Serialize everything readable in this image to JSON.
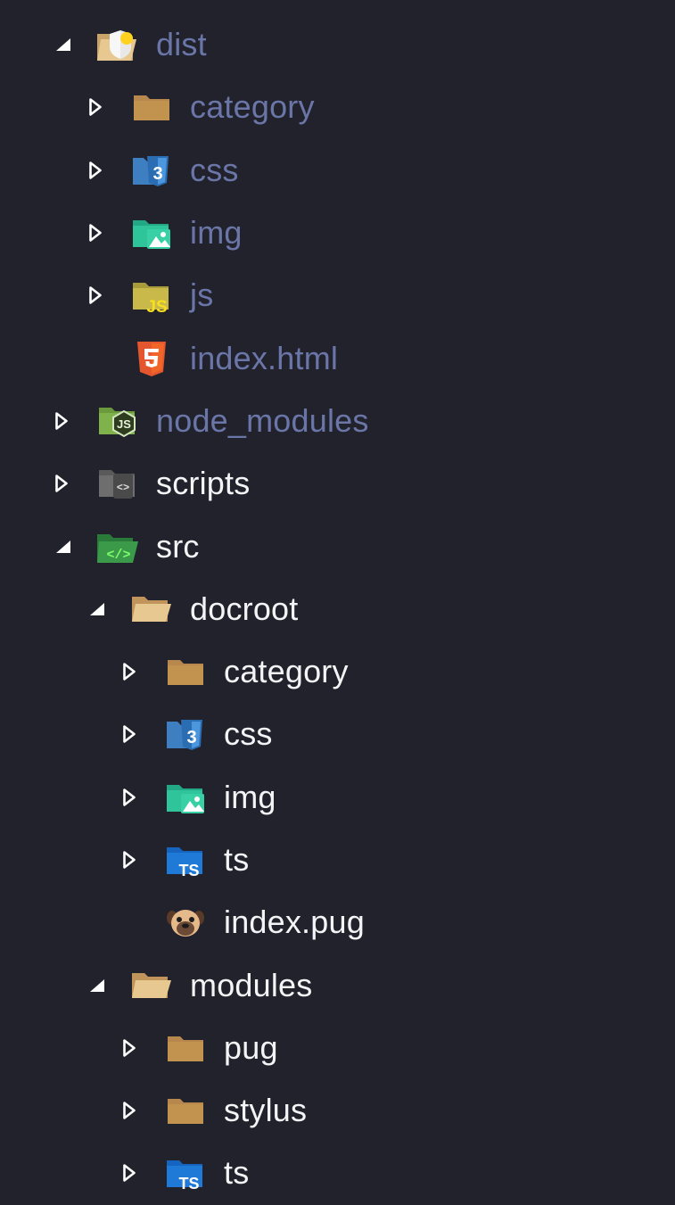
{
  "colors": {
    "background": "#21222c",
    "ignored_text": "#6b76a8",
    "normal_text": "#f4f4f6"
  },
  "tree": {
    "dist": {
      "label": "dist",
      "icon": "folder-dist-open-icon",
      "expanded": true
    },
    "dist_category": {
      "label": "category",
      "icon": "folder-icon"
    },
    "dist_css": {
      "label": "css",
      "icon": "folder-css-icon"
    },
    "dist_img": {
      "label": "img",
      "icon": "folder-images-icon"
    },
    "dist_js": {
      "label": "js",
      "icon": "folder-js-icon"
    },
    "dist_index_html": {
      "label": "index.html",
      "icon": "html5-file-icon"
    },
    "node_modules": {
      "label": "node_modules",
      "icon": "folder-node-icon"
    },
    "scripts": {
      "label": "scripts",
      "icon": "folder-scripts-icon"
    },
    "src": {
      "label": "src",
      "icon": "folder-src-open-icon",
      "expanded": true
    },
    "docroot": {
      "label": "docroot",
      "icon": "folder-open-icon",
      "expanded": true
    },
    "docroot_category": {
      "label": "category",
      "icon": "folder-icon"
    },
    "docroot_css": {
      "label": "css",
      "icon": "folder-css-icon"
    },
    "docroot_img": {
      "label": "img",
      "icon": "folder-images-icon"
    },
    "docroot_ts": {
      "label": "ts",
      "icon": "folder-typescript-icon"
    },
    "docroot_index_pug": {
      "label": "index.pug",
      "icon": "pug-file-icon"
    },
    "modules": {
      "label": "modules",
      "icon": "folder-open-icon",
      "expanded": true
    },
    "modules_pug": {
      "label": "pug",
      "icon": "folder-icon"
    },
    "modules_stylus": {
      "label": "stylus",
      "icon": "folder-icon"
    },
    "modules_ts": {
      "label": "ts",
      "icon": "folder-typescript-icon"
    }
  }
}
